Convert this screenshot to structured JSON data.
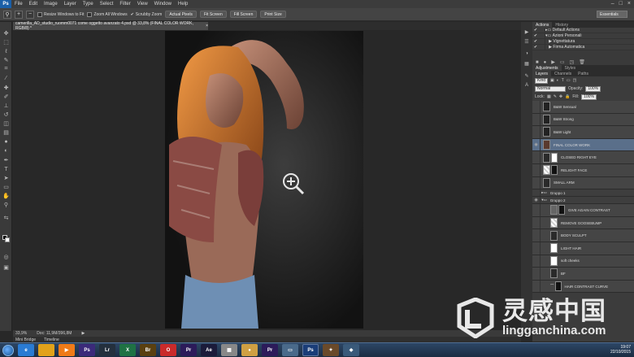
{
  "app": {
    "logo": "Ps",
    "window_controls": [
      "–",
      "□",
      "×"
    ]
  },
  "menu": [
    "File",
    "Edit",
    "Image",
    "Layer",
    "Type",
    "Select",
    "Filter",
    "View",
    "Window",
    "Help"
  ],
  "options": {
    "resize_label": "Resize Windows to Fit",
    "zoom_all_label": "Zoom All Windows",
    "scrubby_label": "Scrubby Zoom",
    "buttons": [
      "Actual Pixels",
      "Fit Screen",
      "Fill Screen",
      "Print Size"
    ],
    "workspace": "Essentials"
  },
  "document": {
    "tab_title": "camerilla_AD_studio_ruomm0071 come oggetto avanzato 4.psd @ 33,8% (FINAL COLOR WORK, RGB/8) *",
    "tab_close": "×",
    "zoom": "33,9%",
    "doc_info": "Doc: 11,9M/396,8M",
    "bottom_tabs": [
      "Mini Bridge",
      "Timeline"
    ]
  },
  "panels": {
    "actions_tabs": [
      "Actions",
      "History"
    ],
    "actions_items": [
      "Default Actions",
      "Azioni Personali",
      "Vignettatura",
      "Firma Automatica"
    ],
    "adjustments_tabs": [
      "Adjustments",
      "Styles"
    ],
    "layers_tabs": [
      "Layers",
      "Channels",
      "Paths"
    ],
    "kind": "Kind",
    "blend": "Normal",
    "opacity_label": "Opacity:",
    "opacity": "100%",
    "lock_label": "Lock:",
    "fill_label": "Fill:",
    "fill": "100%",
    "layers": [
      "B&W Sensual",
      "B&W Strong",
      "B&W Light",
      "FINAL COLOR WORK",
      "CLOSED RIGHT EYE",
      "RELIGHT FACE",
      "SMALL ARM",
      "Gruppo 1",
      "Gruppo 2",
      "GIVE AGAIN CONTRAST",
      "REMOVE GOOSEBUMP",
      "BODY SCULPT",
      "LIGHT HAIR",
      "soft cheeks",
      "BF",
      "HAIR CONTRAST CURVE"
    ]
  },
  "taskbar": {
    "apps": [
      "e",
      "W",
      "P",
      "Ps",
      "Lr",
      "X",
      "Br",
      "",
      "Pr",
      "Ae",
      "",
      "",
      "Pr",
      "",
      "Ps",
      "",
      "",
      ""
    ],
    "time": "19:07",
    "date": "22/10/2015"
  },
  "watermark": {
    "cn": "灵感中国",
    "url": "lingganchina.com"
  },
  "colors": {
    "accent": "#1a5fa8",
    "selection": "#5a6f8a",
    "hair": "#d9772a",
    "shirt": "#8a4a44",
    "jeans": "#6e8fb4"
  }
}
